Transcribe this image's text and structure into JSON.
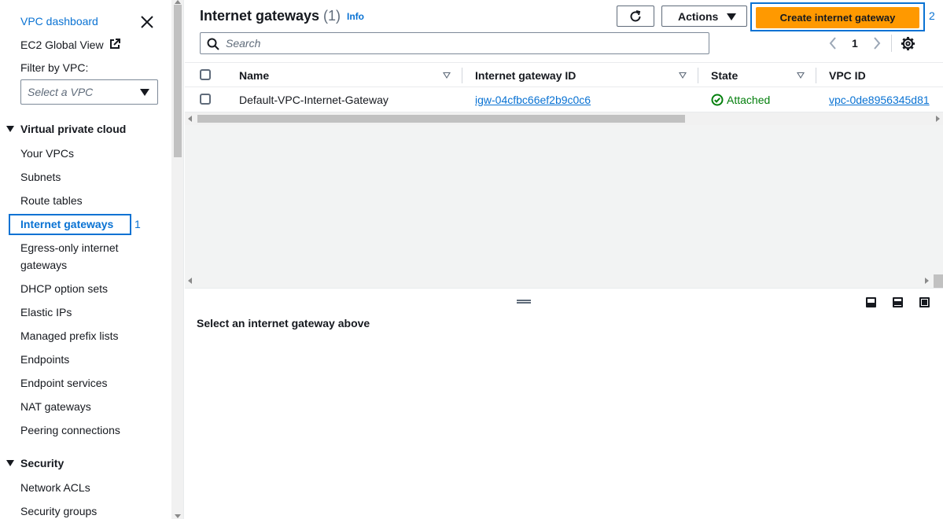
{
  "sidebar": {
    "dashboard_link": "VPC dashboard",
    "ec2_global_view": "EC2 Global View",
    "filter_label": "Filter by VPC:",
    "filter_placeholder": "Select a VPC",
    "sections": [
      {
        "title": "Virtual private cloud",
        "items": [
          "Your VPCs",
          "Subnets",
          "Route tables",
          "Internet gateways",
          "Egress-only internet gateways",
          "DHCP option sets",
          "Elastic IPs",
          "Managed prefix lists",
          "Endpoints",
          "Endpoint services",
          "NAT gateways",
          "Peering connections"
        ]
      },
      {
        "title": "Security",
        "items": [
          "Network ACLs",
          "Security groups"
        ]
      }
    ],
    "active_item": "Internet gateways",
    "active_marker": "1"
  },
  "header": {
    "title": "Internet gateways",
    "count": "(1)",
    "info": "Info",
    "actions_label": "Actions",
    "create_label": "Create internet gateway",
    "create_marker": "2"
  },
  "search": {
    "placeholder": "Search"
  },
  "pagination": {
    "current_page": "1"
  },
  "table": {
    "columns": [
      "Name",
      "Internet gateway ID",
      "State",
      "VPC ID"
    ],
    "rows": [
      {
        "name": "Default-VPC-Internet-Gateway",
        "id": "igw-04cfbc66ef2b9c0c6",
        "state": "Attached",
        "vpc_id": "vpc-0de8956345d81"
      }
    ]
  },
  "details": {
    "empty_message": "Select an internet gateway above"
  },
  "colors": {
    "accent": "#0972d3",
    "primary_button": "#ff9900",
    "success": "#037f0c"
  }
}
